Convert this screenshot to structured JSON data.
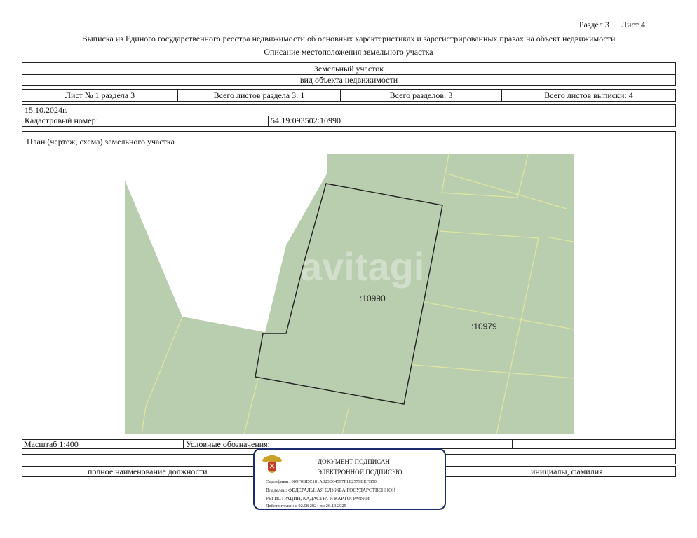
{
  "header": {
    "section": "Раздел 3",
    "sheet": "Лист 4",
    "title": "Выписка из Единого государственного реестра недвижимости об основных характеристиках и зарегистрированных правах на объект недвижимости",
    "subtitle": "Описание местоположения земельного участка"
  },
  "object": {
    "type": "Земельный участок",
    "type_caption": "вид объекта недвижимости"
  },
  "sheet_info": {
    "sheet_of_section": "Лист № 1 раздела 3",
    "total_sheets_section": "Всего листов раздела 3: 1",
    "total_sections": "Всего разделов: 3",
    "total_sheets_extract": "Всего листов выписки: 4"
  },
  "date": "15.10.2024г.",
  "cadastral": {
    "label": "Кадастровый номер:",
    "value": "54:19:093502:10990"
  },
  "plan": {
    "label": "План (чертеж, схема) земельного участка",
    "parcel_main": ":10990",
    "parcel_neighbor": ":10979",
    "watermark": "avitagi",
    "colors": {
      "fill": "#b9ceae",
      "outline": "#222222",
      "boundary": "#dfe6a2"
    }
  },
  "footer": {
    "scale": "Масштаб 1:400",
    "legend": "Условные обозначения:",
    "position_caption": "полное наименование должности",
    "initials_caption": "инициалы, фамилия"
  },
  "stamp": {
    "line1": "ДОКУМЕНТ ПОДПИСАН",
    "line2": "ЭЛЕКТРОННОЙ ПОДПИСЬЮ",
    "certificate": "Сертификат: 009F0BDC181A023B64597F1E2579BEFB50",
    "owner": "Владелец: ФЕДЕРАЛЬНАЯ СЛУЖБА ГОСУДАРСТВЕННОЙ",
    "owner2": "РЕГИСТРАЦИИ, КАДАСТРА И КАРТОГРАФИИ",
    "valid": "Действителен: с 02.08.2024 по 26.10.2025",
    "border_color": "#1a2a6c"
  }
}
